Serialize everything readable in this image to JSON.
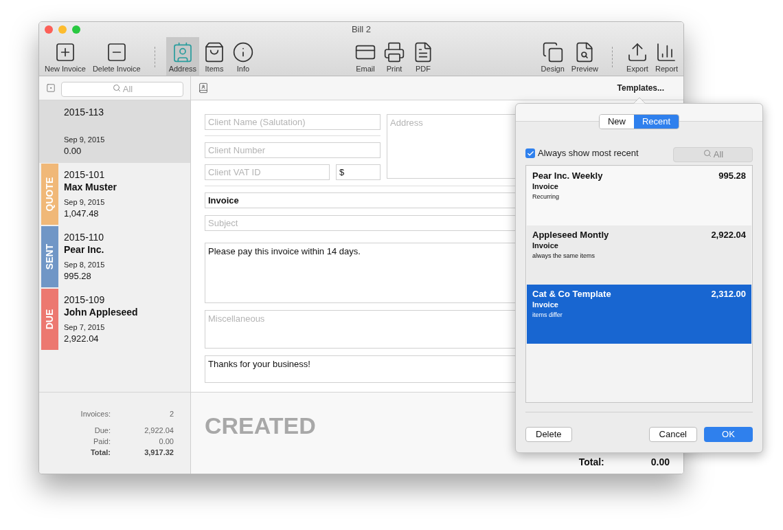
{
  "window": {
    "title": "Bill 2"
  },
  "toolbar": [
    {
      "items": [
        {
          "label": "New Invoice",
          "selected": false
        },
        {
          "label": "Delete Invoice",
          "selected": false
        }
      ]
    },
    {
      "items": [
        {
          "label": "Address",
          "selected": true
        },
        {
          "label": "Items",
          "selected": false
        },
        {
          "label": "Info",
          "selected": false
        }
      ]
    },
    {
      "items": [
        {
          "label": "Email",
          "selected": false
        },
        {
          "label": "Print",
          "selected": false
        },
        {
          "label": "PDF",
          "selected": false
        }
      ]
    },
    {
      "items": [
        {
          "label": "Design",
          "selected": false
        },
        {
          "label": "Preview",
          "selected": false
        }
      ]
    },
    {
      "items": [
        {
          "label": "Export",
          "selected": false
        },
        {
          "label": "Report",
          "selected": false
        }
      ]
    }
  ],
  "sidebar": {
    "search": {
      "placeholder": "All"
    },
    "invoices": [
      {
        "number": "2015-113",
        "date": "Sep 9, 2015",
        "amount": "0.00",
        "selected": true
      },
      {
        "number": "2015-101",
        "client": "Max Muster",
        "date": "Sep 9, 2015",
        "amount": "1,047.48",
        "selected": false,
        "status": "QUOTE",
        "color": "#f0b878"
      },
      {
        "number": "2015-110",
        "client": "Pear Inc.",
        "date": "Sep 8, 2015",
        "amount": "995.28",
        "selected": false,
        "status": "SENT",
        "color": "#7096c6"
      },
      {
        "number": "2015-109",
        "client": "John Appleseed",
        "date": "Sep 7, 2015",
        "amount": "2,922.04",
        "selected": false,
        "status": "DUE",
        "color": "#ec7870"
      }
    ],
    "summary": [
      {
        "label": "Invoices:",
        "value": "2",
        "bold": false
      },
      {
        "label": "Due:",
        "value": "2,922.04",
        "bold": false
      },
      {
        "label": "Paid:",
        "value": "0.00",
        "bold": false
      },
      {
        "label": "Total:",
        "value": "3,917.32",
        "bold": true
      }
    ]
  },
  "templates_button": "Templates...",
  "form": {
    "client_name": {
      "placeholder": "Client Name (Salutation)"
    },
    "client_number": {
      "placeholder": "Client Number"
    },
    "client_vat": {
      "placeholder": "Client VAT ID"
    },
    "currency": {
      "value": "$"
    },
    "address": {
      "placeholder": "Address"
    },
    "title": {
      "value": "Invoice"
    },
    "subject": {
      "placeholder": "Subject"
    },
    "notes": {
      "value": "Please pay this invoice within 14 days."
    },
    "miscellaneous": {
      "placeholder": "Miscellaneous"
    },
    "closing": {
      "value": "Thanks for your business!"
    }
  },
  "footer": {
    "state": "CREATED",
    "total_label": "Total:",
    "total": "0.00"
  },
  "popover": {
    "tabs": [
      {
        "label": "New",
        "selected": false
      },
      {
        "label": "Recent",
        "selected": true
      }
    ],
    "always_show_recent": {
      "label": "Always show most recent",
      "checked": true
    },
    "search": {
      "placeholder": "All"
    },
    "templates": [
      {
        "name": "Pear Inc. Weekly",
        "type": "Invoice",
        "note": "Recurring",
        "amount": "995.28",
        "selected": false
      },
      {
        "name": "Appleseed Montly",
        "type": "Invoice",
        "note": "always the same items",
        "amount": "2,922.04",
        "selected": false
      },
      {
        "name": "Cat & Co Template",
        "type": "Invoice",
        "note": "items differ",
        "amount": "2,312.00",
        "selected": true
      }
    ],
    "buttons": [
      {
        "label": "Delete",
        "kind": "plain"
      },
      {
        "label": "Cancel",
        "kind": "plain"
      },
      {
        "label": "OK",
        "kind": "default"
      }
    ]
  }
}
